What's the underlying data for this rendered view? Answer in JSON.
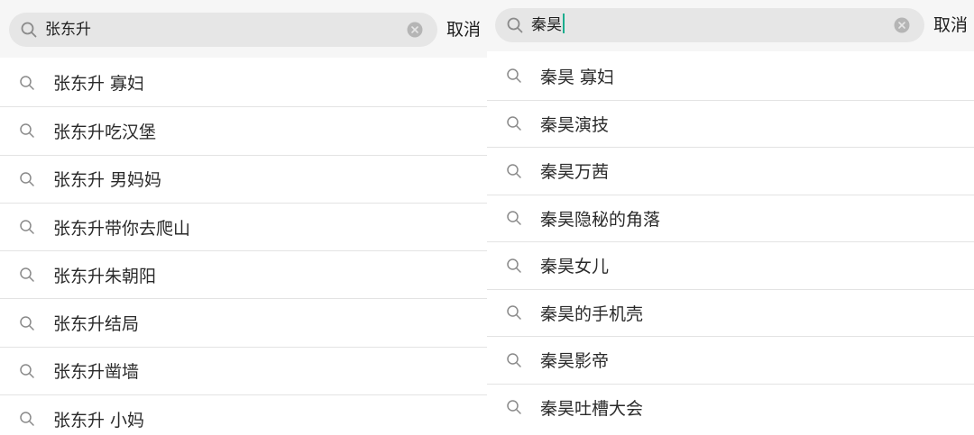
{
  "colors": {
    "header_bg": "#f6f6f6",
    "search_box_bg": "#e6e6e6",
    "caret": "#1aad8e",
    "text": "#2a2a2a",
    "icon": "#8a8a8a",
    "divider": "#e3e3e3"
  },
  "left": {
    "search": {
      "value": "张东升",
      "cancel_label": "取消"
    },
    "suggestions": [
      "张东升 寡妇",
      "张东升吃汉堡",
      "张东升 男妈妈",
      "张东升带你去爬山",
      "张东升朱朝阳",
      "张东升结局",
      "张东升凿墙",
      "张东升 小妈"
    ]
  },
  "right": {
    "search": {
      "value": "秦昊",
      "cancel_label": "取消"
    },
    "suggestions": [
      "秦昊 寡妇",
      "秦昊演技",
      "秦昊万茜",
      "秦昊隐秘的角落",
      "秦昊女儿",
      "秦昊的手机壳",
      "秦昊影帝",
      "秦昊吐槽大会"
    ]
  },
  "icons": {
    "search": "search-icon",
    "clear": "clear-icon"
  }
}
